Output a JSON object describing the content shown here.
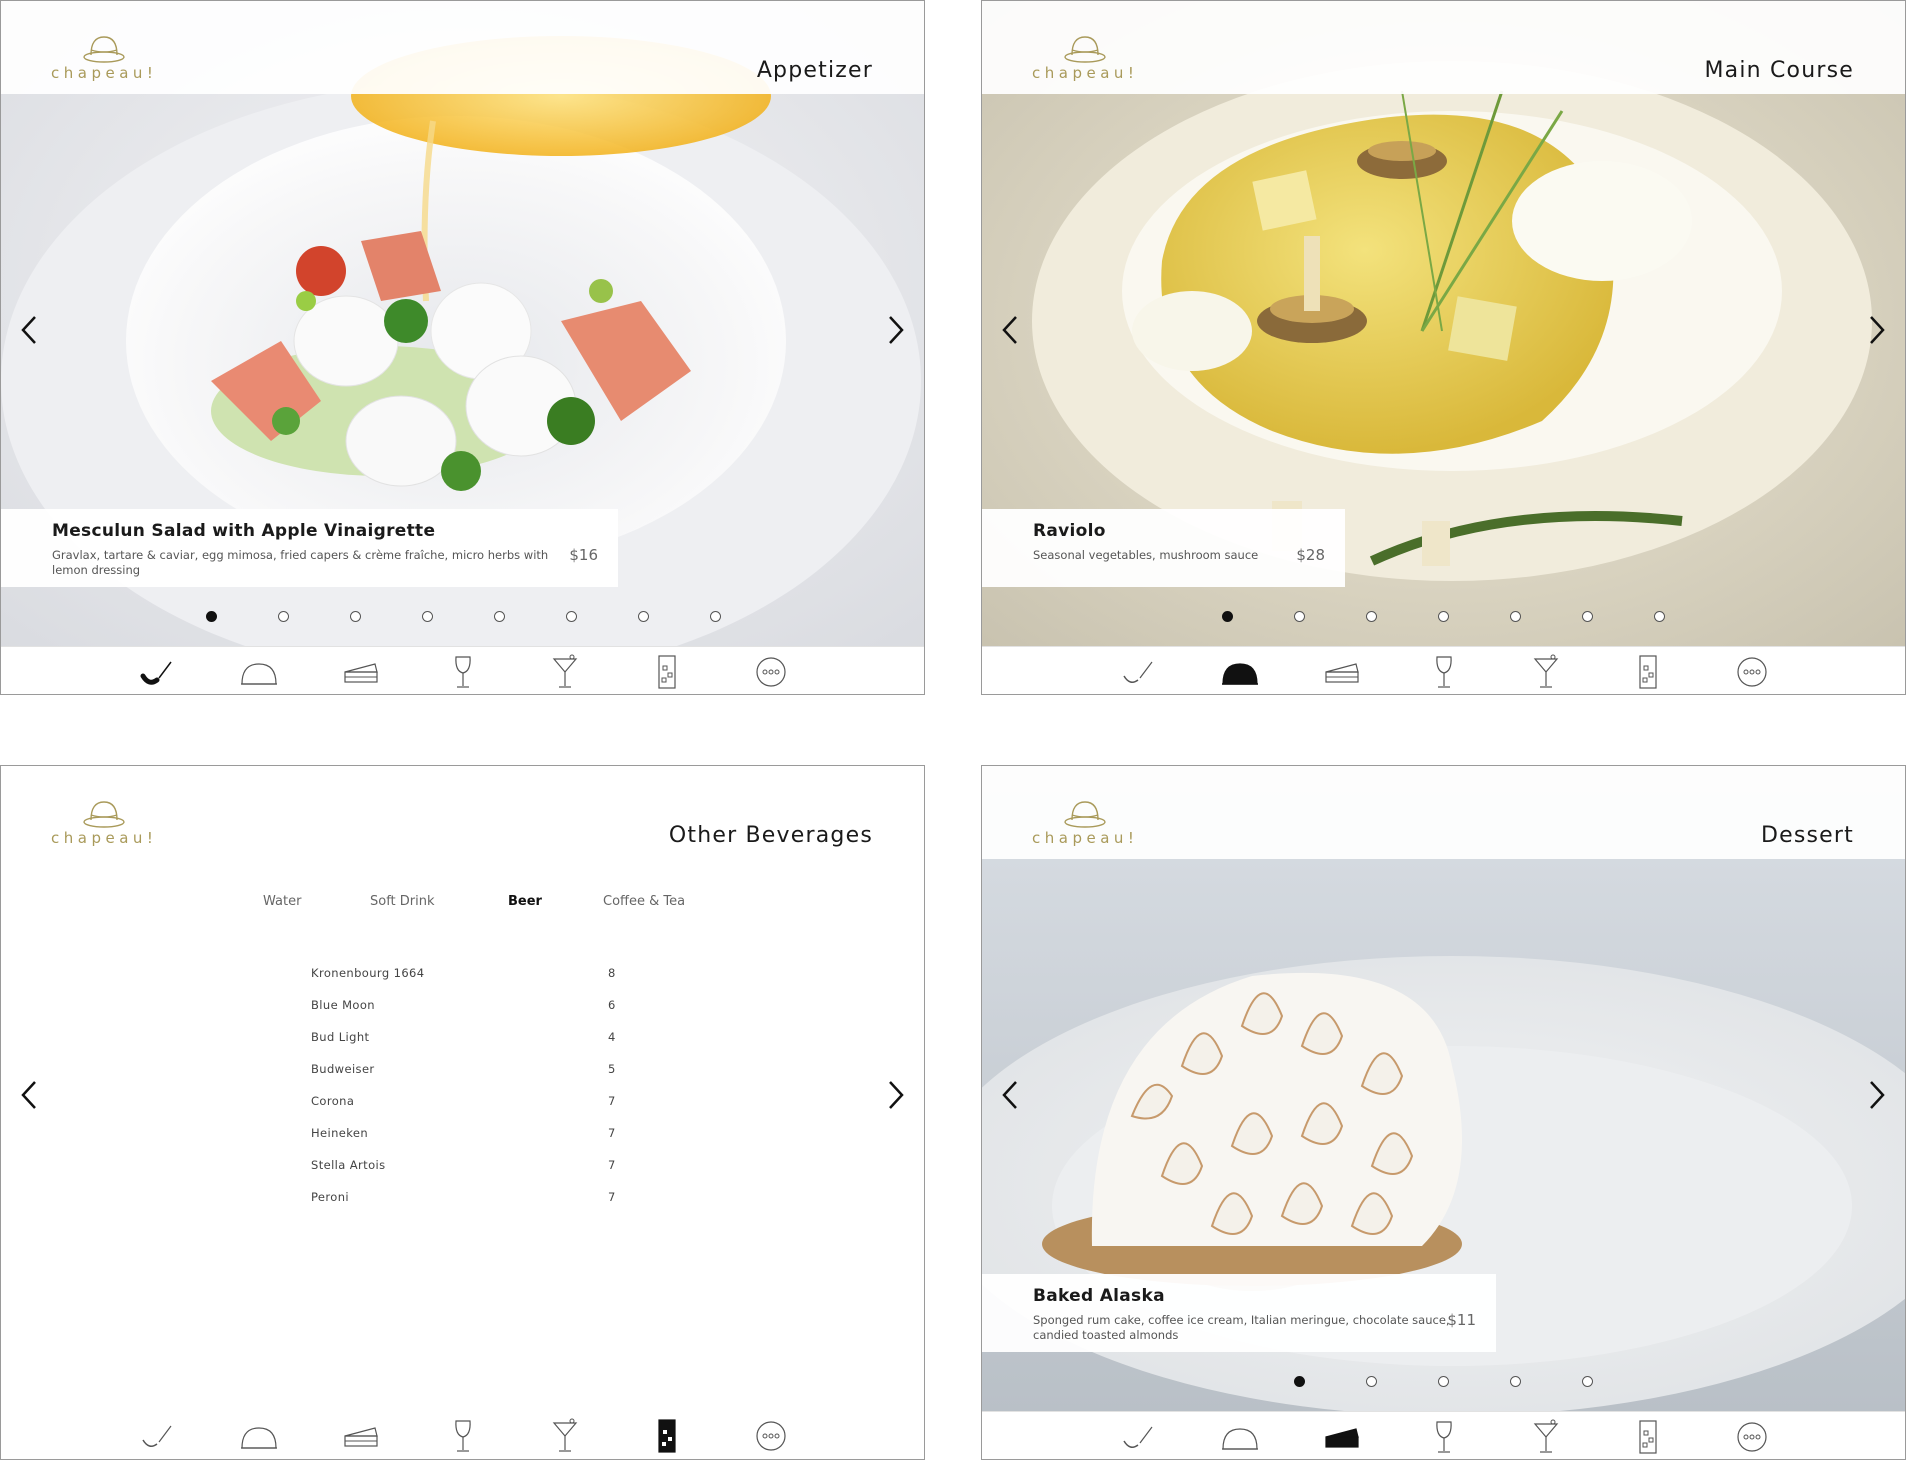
{
  "brand": {
    "logo_text": "chapeau!",
    "logo_color": "#a99a5a"
  },
  "nav": {
    "prev_label": "previous",
    "next_label": "next"
  },
  "tabbar_icons": [
    "appetizer-icon",
    "main-course-icon",
    "dessert-icon",
    "wine-icon",
    "cocktail-icon",
    "other-beverages-icon",
    "more-icon"
  ],
  "screens": [
    {
      "title": "Appetizer",
      "active_tab": "appetizer-icon",
      "dish": {
        "name": "Mesculun Salad with Apple Vinaigrette",
        "description": "Gravlax, tartare & caviar, egg mimosa, fried capers & crème fraîche, micro herbs with lemon dressing",
        "price": "$16"
      },
      "pagination": {
        "count": 8,
        "current": 1
      }
    },
    {
      "title": "Main Course",
      "active_tab": "main-course-icon",
      "dish": {
        "name": "Raviolo",
        "description": "Seasonal vegetables, mushroom sauce",
        "price": "$28"
      },
      "pagination": {
        "count": 7,
        "current": 1
      }
    },
    {
      "title": "Other Beverages",
      "active_tab": "other-beverages-icon",
      "categories": [
        "Water",
        "Soft Drink",
        "Beer",
        "Coffee & Tea"
      ],
      "active_category": "Beer",
      "items": [
        {
          "name": "Kronenbourg 1664",
          "price": "8"
        },
        {
          "name": "Blue Moon",
          "price": "6"
        },
        {
          "name": "Bud Light",
          "price": "4"
        },
        {
          "name": "Budweiser",
          "price": "5"
        },
        {
          "name": "Corona",
          "price": "7"
        },
        {
          "name": "Heineken",
          "price": "7"
        },
        {
          "name": "Stella Artois",
          "price": "7"
        },
        {
          "name": "Peroni",
          "price": "7"
        }
      ]
    },
    {
      "title": "Dessert",
      "active_tab": "dessert-icon",
      "dish": {
        "name": "Baked Alaska",
        "description": "Sponged rum cake, coffee ice cream, Italian meringue, chocolate sauce, candied toasted almonds",
        "price": "$11"
      },
      "pagination": {
        "count": 5,
        "current": 1
      }
    }
  ]
}
